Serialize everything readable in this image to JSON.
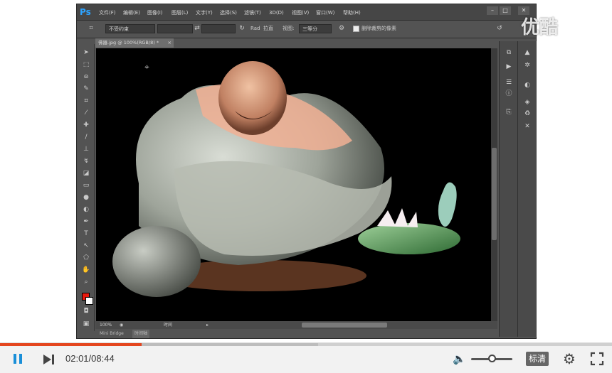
{
  "photoshop": {
    "logo": "Ps",
    "menus": [
      "文件(F)",
      "编辑(E)",
      "图像(I)",
      "图层(L)",
      "文字(Y)",
      "选择(S)",
      "滤镜(T)",
      "3D(D)",
      "视图(V)",
      "窗口(W)",
      "帮助(H)"
    ],
    "window_buttons": {
      "minimize": "–",
      "restore": "□",
      "close": "✕"
    },
    "options": {
      "ratio_select": "不受约束",
      "swap_icon": "⇄",
      "straighten_label": "拉直",
      "view_label": "视图:",
      "view_select": "三等分",
      "delete_cropped_label": "删除裁剪的像素"
    },
    "document_tab": {
      "title": "佛器.jpg @ 100%(RGB/8) *",
      "close": "×"
    },
    "status": {
      "zoom": "100%",
      "info": "时间"
    },
    "bridge": {
      "mini_bridge": "Mini Bridge",
      "timeline": "时间轴"
    },
    "tools": [
      "move-icon",
      "marquee-icon",
      "lasso-icon",
      "quick-select-icon",
      "crop-icon",
      "eyedropper-icon",
      "healing-icon",
      "brush-icon",
      "stamp-icon",
      "history-brush-icon",
      "eraser-icon",
      "gradient-icon",
      "blur-icon",
      "dodge-icon",
      "pen-icon",
      "type-icon",
      "path-select-icon",
      "shape-icon",
      "hand-icon",
      "zoom-icon"
    ],
    "colors": {
      "foreground": "#e8190e",
      "background": "#ffffff",
      "accent": "#2da3ff"
    }
  },
  "watermark": "优酷",
  "player": {
    "current_time": "02:01",
    "duration": "08:44",
    "time_text": "02:01/08:44",
    "progress": 0.231,
    "buffered": 0.52,
    "volume": 0.5,
    "quality_label": "标清",
    "colors": {
      "progress": "#e4461f",
      "pause": "#1a8fd8"
    }
  }
}
